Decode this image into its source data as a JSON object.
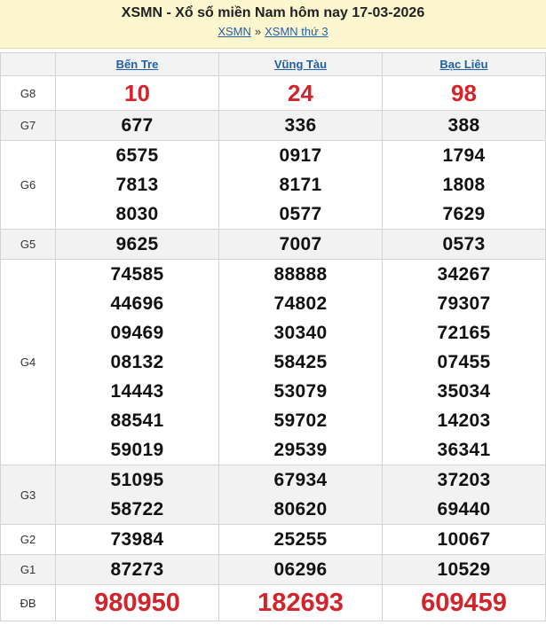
{
  "header": {
    "title": "XSMN - Xổ số miền Nam hôm nay 17-03-2026",
    "breadcrumb": [
      "XSMN",
      "XSMN thứ 3"
    ],
    "separator": "»"
  },
  "provinces": [
    "Bến Tre",
    "Vũng Tàu",
    "Bạc Liêu"
  ],
  "prizes": [
    {
      "label": "G8",
      "style": "red",
      "shaded": false,
      "numbers": [
        [
          "10"
        ],
        [
          "24"
        ],
        [
          "98"
        ]
      ]
    },
    {
      "label": "G7",
      "style": "normal",
      "shaded": true,
      "numbers": [
        [
          "677"
        ],
        [
          "336"
        ],
        [
          "388"
        ]
      ]
    },
    {
      "label": "G6",
      "style": "normal",
      "shaded": false,
      "numbers": [
        [
          "6575",
          "7813",
          "8030"
        ],
        [
          "0917",
          "8171",
          "0577"
        ],
        [
          "1794",
          "1808",
          "7629"
        ]
      ]
    },
    {
      "label": "G5",
      "style": "normal",
      "shaded": true,
      "numbers": [
        [
          "9625"
        ],
        [
          "7007"
        ],
        [
          "0573"
        ]
      ]
    },
    {
      "label": "G4",
      "style": "normal",
      "shaded": false,
      "numbers": [
        [
          "74585",
          "44696",
          "09469",
          "08132",
          "14443",
          "88541",
          "59019"
        ],
        [
          "88888",
          "74802",
          "30340",
          "58425",
          "53079",
          "59702",
          "29539"
        ],
        [
          "34267",
          "79307",
          "72165",
          "07455",
          "35034",
          "14203",
          "36341"
        ]
      ]
    },
    {
      "label": "G3",
      "style": "normal",
      "shaded": true,
      "numbers": [
        [
          "51095",
          "58722"
        ],
        [
          "67934",
          "80620"
        ],
        [
          "37203",
          "69440"
        ]
      ]
    },
    {
      "label": "G2",
      "style": "normal",
      "shaded": false,
      "numbers": [
        [
          "73984"
        ],
        [
          "25255"
        ],
        [
          "10067"
        ]
      ]
    },
    {
      "label": "G1",
      "style": "normal",
      "shaded": true,
      "numbers": [
        [
          "87273"
        ],
        [
          "06296"
        ],
        [
          "10529"
        ]
      ]
    },
    {
      "label": "ĐB",
      "style": "red-big",
      "shaded": false,
      "numbers": [
        [
          "980950"
        ],
        [
          "182693"
        ],
        [
          "609459"
        ]
      ]
    }
  ],
  "colors": {
    "accent_red": "#d2242a",
    "link_blue": "#1f5fa8",
    "header_bg": "#fdf6cf"
  }
}
